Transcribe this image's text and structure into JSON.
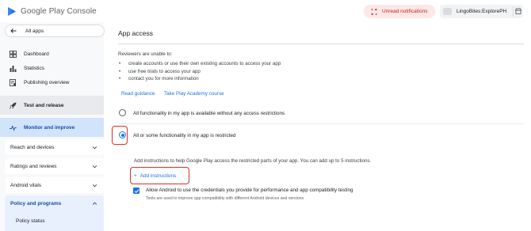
{
  "header": {
    "brand": "Google Play Console",
    "notifications_label": "Unread notifications",
    "account_name": "LingoBites:ExplorePH"
  },
  "sidebar": {
    "all_apps": "All apps",
    "items": [
      {
        "label": "Dashboard",
        "icon": "dashboard-icon"
      },
      {
        "label": "Statistics",
        "icon": "bar-chart-icon"
      },
      {
        "label": "Publishing overview",
        "icon": "publishing-icon"
      },
      {
        "label": "Test and release",
        "icon": "rocket-icon"
      },
      {
        "label": "Monitor and improve",
        "icon": "trend-icon"
      }
    ],
    "sections": [
      {
        "label": "Reach and devices"
      },
      {
        "label": "Ratings and reviews"
      },
      {
        "label": "Android vitals"
      },
      {
        "label": "Policy and programs"
      }
    ],
    "sub_item": "Policy status"
  },
  "main": {
    "title": "App access",
    "reviewers_label": "Reviewers are unable to:",
    "bullets": [
      "create accounts or use their own existing accounts to access your app",
      "use free trials to access your app",
      "contact you for more information"
    ],
    "links": {
      "read_guidance": "Read guidance",
      "academy": "Take Play Academy course"
    },
    "options": {
      "all_available": "All functionality in my app is available without any access restrictions",
      "restricted": "All or some functionality in my app is restricted"
    },
    "instructions_text": "Add instructions to help Google Play access the restricted parts of your app. You can add up to 5 instructions.",
    "add_instructions": "Add instructions",
    "checkbox_label": "Allow Android to use the credentials you provide for performance and app compatibility testing",
    "checkbox_help": "Tests are used to improve app compatibility with different Android devices and versions"
  },
  "colors": {
    "accent": "#1a73e8",
    "highlight": "#d93025",
    "nav_selected": "#d2e3fc"
  }
}
